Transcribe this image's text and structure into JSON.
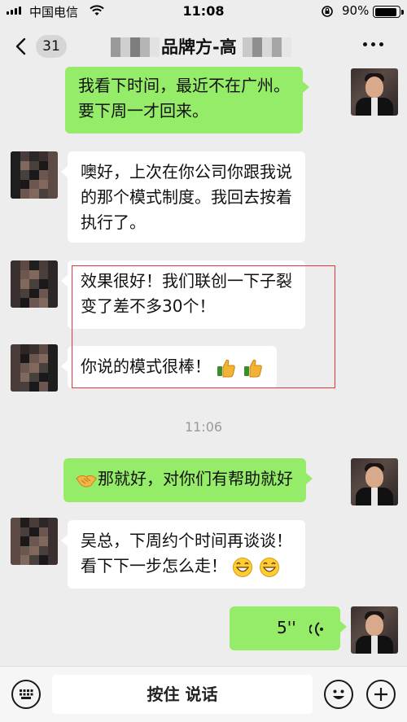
{
  "status_bar": {
    "carrier": "中国电信",
    "time": "11:08",
    "battery": "90%",
    "battery_level": 0.9
  },
  "nav": {
    "unread_count": "31",
    "title_visible": "品牌方-高"
  },
  "messages": [
    {
      "side": "out",
      "lines": [
        "我看下时间，最近不在广州。",
        "要下周一才回来。"
      ]
    },
    {
      "side": "in",
      "lines": [
        "噢好，上次在你公司你跟我说",
        "的那个模式制度。我回去按着",
        "执行了。"
      ]
    },
    {
      "side": "in",
      "lines": [
        "效果很好！我们联创一下子裂",
        "变了差不多30个！"
      ]
    },
    {
      "side": "in",
      "text": "你说的模式很棒！",
      "emoji": [
        "thumbs-up-icon",
        "thumbs-up-icon"
      ]
    },
    {
      "side": "out",
      "text": "那就好，对你们有帮助就好",
      "emoji_before": "handshake-icon"
    },
    {
      "side": "in",
      "lines": [
        "吴总，下周约个时间再谈谈！",
        "看下下一步怎么走！"
      ],
      "emoji": [
        "grinning-face-icon",
        "grinning-face-icon"
      ]
    },
    {
      "side": "out",
      "voice_duration": "5''"
    }
  ],
  "time_divider": "11:06",
  "input_bar": {
    "hold_to_talk": "按住 说话",
    "icons": [
      "keyboard-icon",
      "emoji-face-icon",
      "add-plus-icon"
    ]
  },
  "colors": {
    "background": "#ededed",
    "outgoing_bubble": "#95ec69",
    "incoming_bubble": "#ffffff",
    "highlight_border": "#e03a3a"
  }
}
